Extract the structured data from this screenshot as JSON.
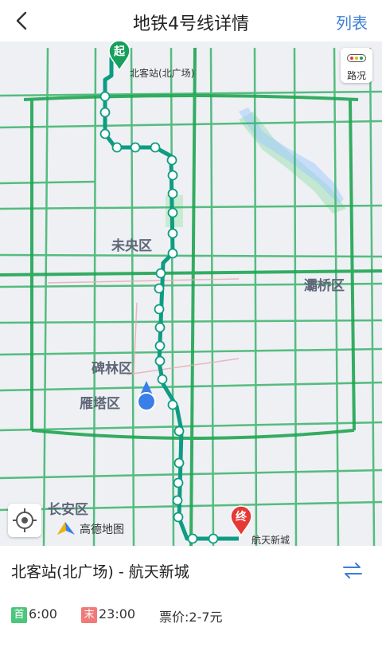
{
  "header": {
    "title": "地铁4号线详情",
    "list_label": "列表"
  },
  "map": {
    "traffic_label": "路况",
    "logo_label": "高德地图",
    "districts": [
      "未央区",
      "灞桥区",
      "碑林区",
      "雁塔区",
      "长安区"
    ],
    "start_badge": "起",
    "end_badge": "终",
    "start_station": "北客站(北广场)",
    "end_station": "航天新城",
    "line_color": "#10a58a"
  },
  "info": {
    "route": "北客站(北广场) - 航天新城",
    "first_badge": "首",
    "first_time": "6:00",
    "last_badge": "末",
    "last_time": "23:00",
    "fare": "票价:2-7元"
  }
}
